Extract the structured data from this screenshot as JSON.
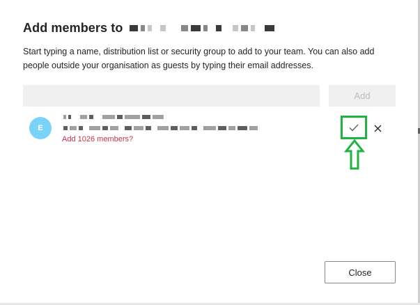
{
  "dialog": {
    "title": "Add members to",
    "description": "Start typing a name, distribution list or security group to add to your team. You can also add people outside your organisation as guests by typing their email addresses."
  },
  "search": {
    "value": "",
    "placeholder": ""
  },
  "add_button": {
    "label": "Add"
  },
  "member": {
    "avatar_initial": "E",
    "suggestion": "Add 1026 members?"
  },
  "footer": {
    "close_label": "Close"
  },
  "colors": {
    "accent_annotation": "#1db33f",
    "avatar": "#79d2f7",
    "suggestion_text": "#c4314b"
  },
  "icons": {
    "confirm": "checkmark-icon",
    "dismiss": "close-icon",
    "annotation": "arrow-up-icon"
  }
}
